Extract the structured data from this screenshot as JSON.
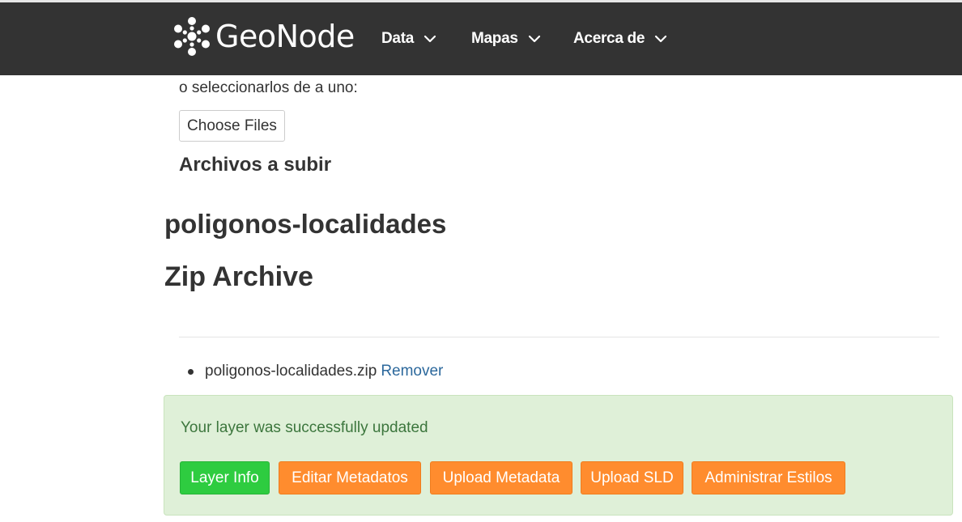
{
  "colors": {
    "navbar_bg": "#333333",
    "alert_bg": "#dff0d8",
    "alert_text": "#3c763d",
    "link": "#2c689c",
    "btn_green": "#2ecc40",
    "btn_orange": "#ff8c2e"
  },
  "navbar": {
    "brand": "GeoNode",
    "brand_icon": "geonode-flower-icon",
    "items": [
      {
        "label": "Data",
        "icon": "chevron-down-icon"
      },
      {
        "label": "Mapas",
        "icon": "chevron-down-icon"
      },
      {
        "label": "Acerca de",
        "icon": "chevron-down-icon"
      }
    ]
  },
  "upload": {
    "select_text": "o seleccionarlos de a uno:",
    "choose_files_label": "Choose Files",
    "files_heading": "Archivos a subir"
  },
  "layer": {
    "name": "poligonos-localidades",
    "type": "Zip Archive",
    "files": [
      {
        "name": "poligonos-localidades.zip",
        "action": "Remover"
      }
    ]
  },
  "alert": {
    "message": "Your layer was successfully updated",
    "buttons": [
      {
        "label": "Layer Info"
      },
      {
        "label": "Editar Metadatos"
      },
      {
        "label": "Upload Metadata"
      },
      {
        "label": "Upload SLD"
      },
      {
        "label": "Administrar Estilos"
      }
    ]
  }
}
